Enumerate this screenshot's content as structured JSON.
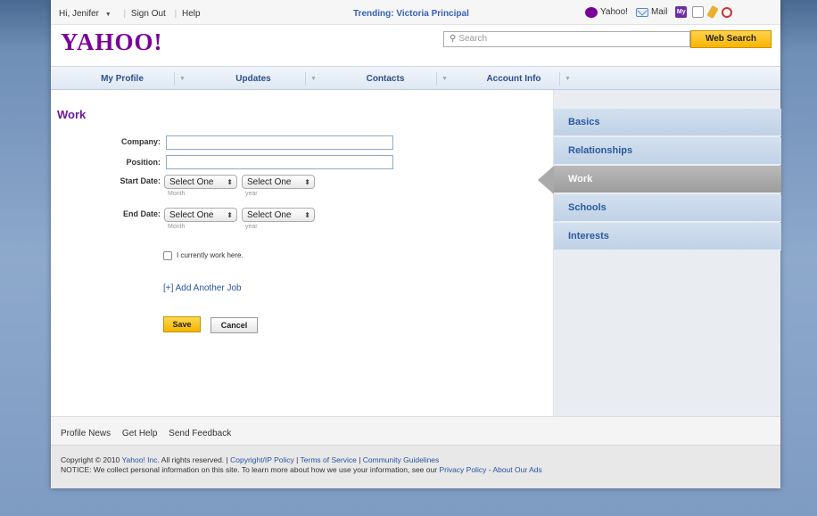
{
  "topbar": {
    "greeting": "Hi, Jenifer",
    "sign_out": "Sign Out",
    "help": "Help",
    "trending": "Trending: Victoria Principal",
    "yahoo_link": "Yahoo!",
    "mail_link": "Mail",
    "my_icon_text": "My"
  },
  "logo": "YAHOO!",
  "search": {
    "placeholder": "Search",
    "button_label": "Web Search"
  },
  "nav": {
    "tabs": [
      {
        "label": "My Profile"
      },
      {
        "label": "Updates"
      },
      {
        "label": "Contacts"
      },
      {
        "label": "Account Info"
      }
    ]
  },
  "form": {
    "section_title": "Work",
    "company_label": "Company:",
    "company_value": "",
    "position_label": "Position:",
    "position_value": "",
    "start_date_label": "Start Date:",
    "start_month": "Select One",
    "start_year": "Select One",
    "end_date_label": "End Date:",
    "end_month": "Select One",
    "end_year": "Select One",
    "month_sub": "Month",
    "year_sub": "year",
    "checkbox_label": "I currently work here.",
    "add_job_label": "[+] Add Another Job",
    "save_label": "Save",
    "cancel_label": "Cancel"
  },
  "sidebar": {
    "items": [
      {
        "label": "Basics",
        "active": false
      },
      {
        "label": "Relationships",
        "active": false
      },
      {
        "label": "Work",
        "active": true
      },
      {
        "label": "Schools",
        "active": false
      },
      {
        "label": "Interests",
        "active": false
      }
    ]
  },
  "footer": {
    "links": [
      "Profile News",
      "Get Help",
      "Send Feedback"
    ],
    "copyright_prefix": "Copyright © 2010",
    "yahoo_inc": "Yahoo! Inc.",
    "rights": "All rights reserved.",
    "copyright_policy": "Copyright/IP Policy",
    "terms": "Terms of Service",
    "guidelines": "Community Guidelines",
    "notice": "NOTICE: We collect personal information on this site. To learn more about how we use your information, see our",
    "privacy": "Privacy Policy",
    "about_ads": "About Our Ads"
  },
  "colors": {
    "brand_purple": "#7b0099",
    "link_blue": "#2952a3",
    "accent_yellow": "#f7b500"
  }
}
